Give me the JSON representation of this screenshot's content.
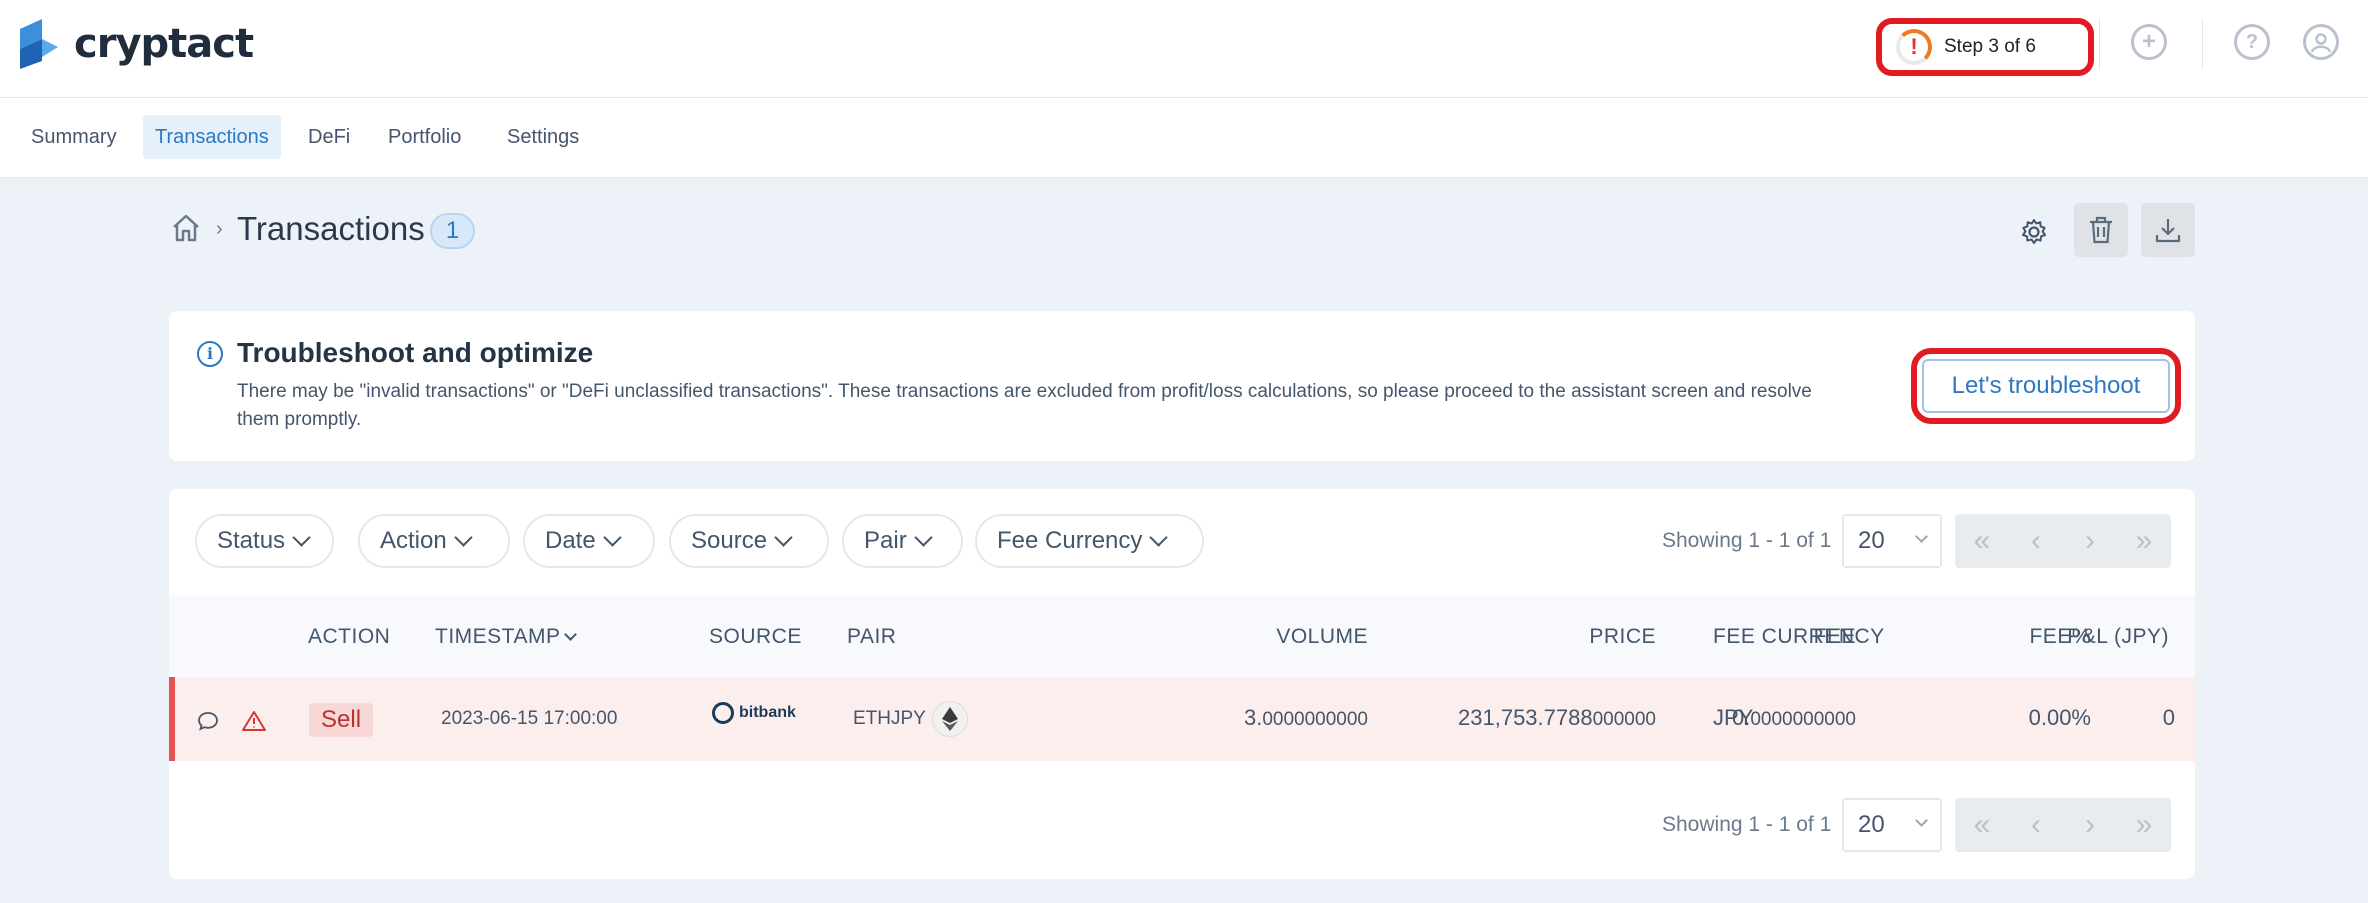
{
  "header": {
    "logo_text": "cryptact",
    "step_label": "Step 3 of 6",
    "step_alert_glyph": "!",
    "icons": [
      "add-icon",
      "help-icon",
      "account-icon"
    ]
  },
  "nav": {
    "tabs": [
      {
        "label": "Summary"
      },
      {
        "label": "Transactions",
        "active": true
      },
      {
        "label": "DeFi"
      },
      {
        "label": "Portfolio"
      },
      {
        "label": "Settings"
      }
    ]
  },
  "breadcrumb": {
    "separator": "›",
    "title": "Transactions",
    "count": "1"
  },
  "alert": {
    "title": "Troubleshoot and optimize",
    "text": "There may be \"invalid transactions\" or \"DeFi unclassified transactions\". These transactions are excluded from profit/loss calculations, so please proceed to the assistant screen and resolve them promptly.",
    "button": "Let's troubleshoot"
  },
  "filters": [
    "Status",
    "Action",
    "Date",
    "Source",
    "Pair",
    "Fee Currency"
  ],
  "pagination": {
    "showing": "Showing 1 - 1 of 1",
    "per_page": "20"
  },
  "table": {
    "columns": {
      "action": "ACTION",
      "timestamp": "TIMESTAMP",
      "source": "SOURCE",
      "pair": "PAIR",
      "volume": "VOLUME",
      "price": "PRICE",
      "fee": "FEE",
      "fee_currency": "FEE CURRENCY",
      "fee_pct": "FEE%",
      "pl": "P&L (JPY)"
    },
    "rows": [
      {
        "action": "Sell",
        "timestamp": "2023-06-15 17:00:00",
        "source": "bitbank",
        "pair": "ETHJPY",
        "volume_int": "3.",
        "volume_frac": "0000000000",
        "price_int": "231,753.7788",
        "price_frac": "000000",
        "fee_int": "0.",
        "fee_frac": "0000000000",
        "fee_currency": "JPY",
        "fee_pct": "0.00%",
        "pl": "0"
      }
    ]
  },
  "colors": {
    "accent": "#2d78c3",
    "highlight": "#e11b22",
    "row_error": "#fdeeee",
    "sell": "#b83232"
  }
}
